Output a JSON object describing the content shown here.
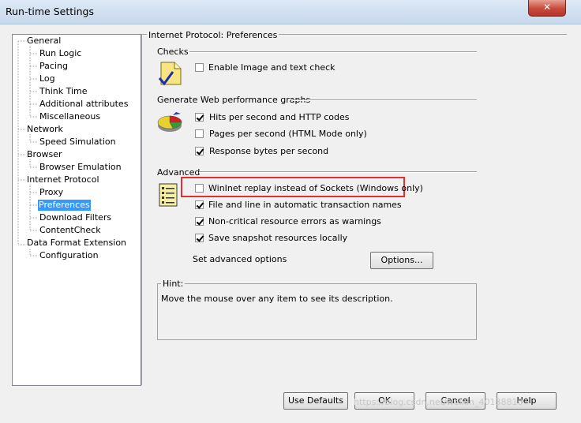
{
  "window": {
    "title": "Run-time Settings",
    "close_glyph": "✕"
  },
  "tree": {
    "items": [
      {
        "label": "General",
        "level": 0
      },
      {
        "label": "Run Logic",
        "level": 1
      },
      {
        "label": "Pacing",
        "level": 1
      },
      {
        "label": "Log",
        "level": 1
      },
      {
        "label": "Think Time",
        "level": 1
      },
      {
        "label": "Additional attributes",
        "level": 1
      },
      {
        "label": "Miscellaneous",
        "level": 1
      },
      {
        "label": "Network",
        "level": 0
      },
      {
        "label": "Speed Simulation",
        "level": 1
      },
      {
        "label": "Browser",
        "level": 0
      },
      {
        "label": "Browser Emulation",
        "level": 1
      },
      {
        "label": "Internet Protocol",
        "level": 0
      },
      {
        "label": "Proxy",
        "level": 1
      },
      {
        "label": "Preferences",
        "level": 1,
        "selected": true
      },
      {
        "label": "Download Filters",
        "level": 1
      },
      {
        "label": "ContentCheck",
        "level": 1
      },
      {
        "label": "Data Format Extension",
        "level": 0
      },
      {
        "label": "Configuration",
        "level": 1
      }
    ]
  },
  "panel": {
    "header": "Internet Protocol: Preferences",
    "checks": {
      "section_label": "Checks",
      "icon": "document-check-icon",
      "options": [
        {
          "label": "Enable Image and text check",
          "checked": false
        }
      ]
    },
    "graphs": {
      "section_label": "Generate Web performance graphs",
      "icon": "pie-chart-icon",
      "options": [
        {
          "label": "Hits per second and HTTP codes",
          "checked": true
        },
        {
          "label": "Pages per second (HTML Mode only)",
          "checked": false
        },
        {
          "label": "Response bytes per second",
          "checked": true
        }
      ]
    },
    "advanced": {
      "section_label": "Advanced",
      "icon": "settings-list-icon",
      "options": [
        {
          "label": "WinInet replay instead of Sockets (Windows only)",
          "checked": false
        },
        {
          "label": "File and line in automatic transaction names",
          "checked": true
        },
        {
          "label": "Non-critical resource errors as warnings",
          "checked": true
        },
        {
          "label": "Save snapshot resources locally",
          "checked": true
        }
      ],
      "set_label": "Set advanced options",
      "options_button": "Options..."
    },
    "hint": {
      "label": "Hint:",
      "text": "Move the mouse over any item to see its description."
    }
  },
  "footer": {
    "use_defaults": "Use Defaults",
    "ok": "OK",
    "cancel": "Cancel",
    "help": "Help"
  },
  "watermark": "https://blog.csdn.net/weixin_40138810",
  "colors": {
    "selection": "#3399ff",
    "highlight_box": "#e03030"
  }
}
